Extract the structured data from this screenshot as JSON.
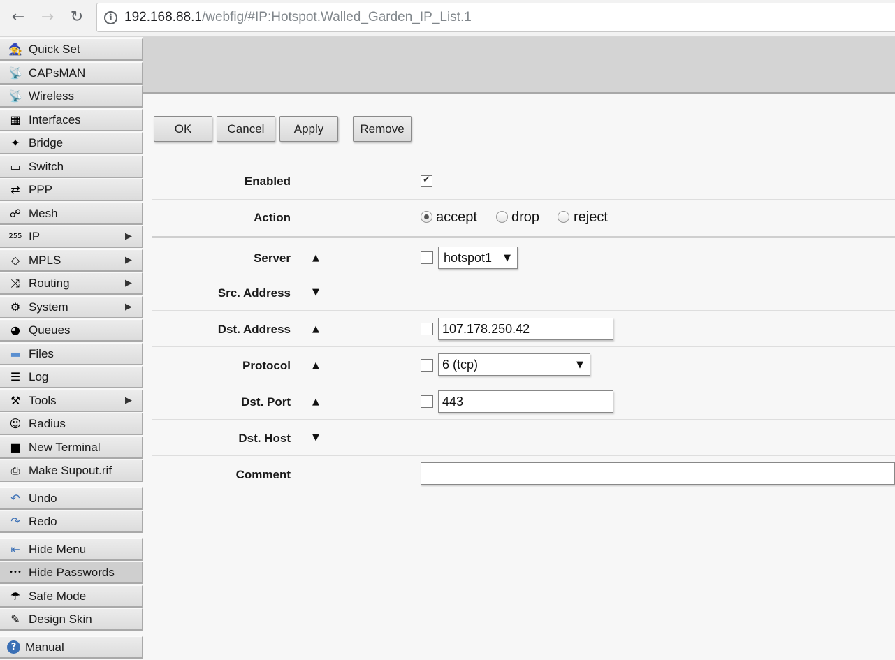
{
  "browser": {
    "back_icon": "←",
    "forward_icon": "→",
    "reload_icon": "↻",
    "info_icon": "i",
    "url_host": "192.168.88.1",
    "url_path": "/webfig/#IP:Hotspot.Walled_Garden_IP_List.1"
  },
  "sidebar": {
    "items": [
      {
        "label": "Quick Set",
        "icon": "🧙",
        "arrow": ""
      },
      {
        "label": "CAPsMAN",
        "icon": "📡",
        "arrow": ""
      },
      {
        "label": "Wireless",
        "icon": "📡",
        "arrow": ""
      },
      {
        "label": "Interfaces",
        "icon": "▦",
        "arrow": ""
      },
      {
        "label": "Bridge",
        "icon": "✦",
        "arrow": ""
      },
      {
        "label": "Switch",
        "icon": "▭",
        "arrow": ""
      },
      {
        "label": "PPP",
        "icon": "⇄",
        "arrow": ""
      },
      {
        "label": "Mesh",
        "icon": "☍",
        "arrow": ""
      },
      {
        "label": "IP",
        "icon": "255",
        "arrow": "▶"
      },
      {
        "label": "MPLS",
        "icon": "◇",
        "arrow": "▶"
      },
      {
        "label": "Routing",
        "icon": "⤨",
        "arrow": "▶"
      },
      {
        "label": "System",
        "icon": "⚙",
        "arrow": "▶"
      },
      {
        "label": "Queues",
        "icon": "◕",
        "arrow": ""
      },
      {
        "label": "Files",
        "icon": "▬",
        "arrow": ""
      },
      {
        "label": "Log",
        "icon": "☰",
        "arrow": ""
      },
      {
        "label": "Tools",
        "icon": "⚒",
        "arrow": "▶"
      },
      {
        "label": "Radius",
        "icon": "☺",
        "arrow": ""
      },
      {
        "label": "New Terminal",
        "icon": "■",
        "arrow": ""
      },
      {
        "label": "Make Supout.rif",
        "icon": "⎙",
        "arrow": ""
      },
      {
        "label": "Undo",
        "icon": "↶",
        "arrow": ""
      },
      {
        "label": "Redo",
        "icon": "↷",
        "arrow": ""
      },
      {
        "label": "Hide Menu",
        "icon": "⇤",
        "arrow": ""
      },
      {
        "label": "Hide Passwords",
        "icon": "•••",
        "arrow": ""
      },
      {
        "label": "Safe Mode",
        "icon": "☂",
        "arrow": ""
      },
      {
        "label": "Design Skin",
        "icon": "✎",
        "arrow": ""
      },
      {
        "label": "Manual",
        "icon": "?",
        "arrow": ""
      }
    ]
  },
  "toolbar": {
    "ok": "OK",
    "cancel": "Cancel",
    "apply": "Apply",
    "remove": "Remove"
  },
  "form": {
    "enabled": {
      "label": "Enabled",
      "checked": true
    },
    "action": {
      "label": "Action",
      "options": [
        "accept",
        "drop",
        "reject"
      ],
      "selected": "accept"
    },
    "server": {
      "label": "Server",
      "value": "hotspot1",
      "caret": "▼",
      "toggle": "▲"
    },
    "src_address": {
      "label": "Src. Address",
      "toggle": "▼"
    },
    "dst_address": {
      "label": "Dst. Address",
      "value": "107.178.250.42",
      "toggle": "▲"
    },
    "protocol": {
      "label": "Protocol",
      "value": "6 (tcp)",
      "caret": "▼",
      "toggle": "▲"
    },
    "dst_port": {
      "label": "Dst. Port",
      "value": "443",
      "toggle": "▲"
    },
    "dst_host": {
      "label": "Dst. Host",
      "toggle": "▼"
    },
    "comment": {
      "label": "Comment",
      "value": ""
    }
  }
}
